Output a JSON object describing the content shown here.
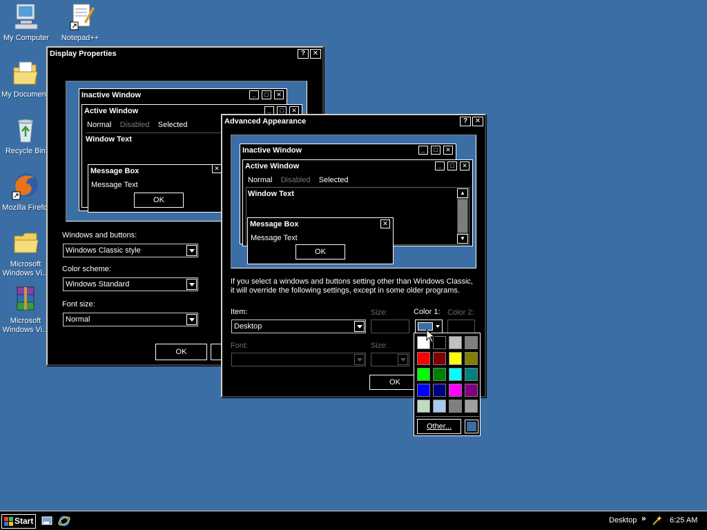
{
  "desktop": {
    "icons": [
      {
        "label": "My Computer"
      },
      {
        "label": "Notepad++"
      },
      {
        "label": "My Document"
      },
      {
        "label": "Recycle Bin"
      },
      {
        "label": "Mozilla Firefo"
      },
      {
        "label": "Microsoft\nWindows Vi..."
      },
      {
        "label": "Microsoft\nWindows Vi..."
      }
    ]
  },
  "display_properties": {
    "title": "Display Properties",
    "help": "?",
    "close": "✕",
    "preview": {
      "inactive_title": "Inactive Window",
      "active_title": "Active Window",
      "menu_normal": "Normal",
      "menu_disabled": "Disabled",
      "menu_selected": "Selected",
      "window_text": "Window Text",
      "msgbox_title": "Message Box",
      "msgbox_text": "Message Text",
      "msgbox_ok": "OK"
    },
    "windows_buttons_label": "Windows and buttons:",
    "windows_buttons_value": "Windows Classic style",
    "color_scheme_label": "Color scheme:",
    "color_scheme_value": "Windows Standard",
    "font_size_label": "Font size:",
    "font_size_value": "Normal",
    "ok": "OK"
  },
  "advanced_appearance": {
    "title": "Advanced Appearance",
    "help": "?",
    "close": "✕",
    "preview": {
      "inactive_title": "Inactive Window",
      "active_title": "Active Window",
      "menu_normal": "Normal",
      "menu_disabled": "Disabled",
      "menu_selected": "Selected",
      "window_text": "Window Text",
      "msgbox_title": "Message Box",
      "msgbox_text": "Message Text",
      "msgbox_ok": "OK"
    },
    "note_line1": "If you select a windows and buttons setting other than Windows Classic,",
    "note_line2": "it will override the following settings, except in some older programs.",
    "item_label": "Item:",
    "item_value": "Desktop",
    "size_label": "Size:",
    "color1_label": "Color 1:",
    "color2_label": "Color 2:",
    "font_label": "Font:",
    "font_size_label": "Size:",
    "ok": "OK"
  },
  "palette": {
    "colors": [
      "#ffffff",
      "#000000",
      "#c0c0c0",
      "#808080",
      "#ff0000",
      "#800000",
      "#ffff00",
      "#808000",
      "#00ff00",
      "#008000",
      "#00ffff",
      "#008080",
      "#0000ff",
      "#000080",
      "#ff00ff",
      "#800080",
      "#c0dcc0",
      "#a6caf0",
      "#808080",
      "#a0a0a4"
    ],
    "other_label": "Other...",
    "current_color": "#3a6ea5"
  },
  "taskbar": {
    "start": "Start",
    "toolbar_label": "Desktop",
    "chevron": "»",
    "clock": "6:25 AM"
  }
}
